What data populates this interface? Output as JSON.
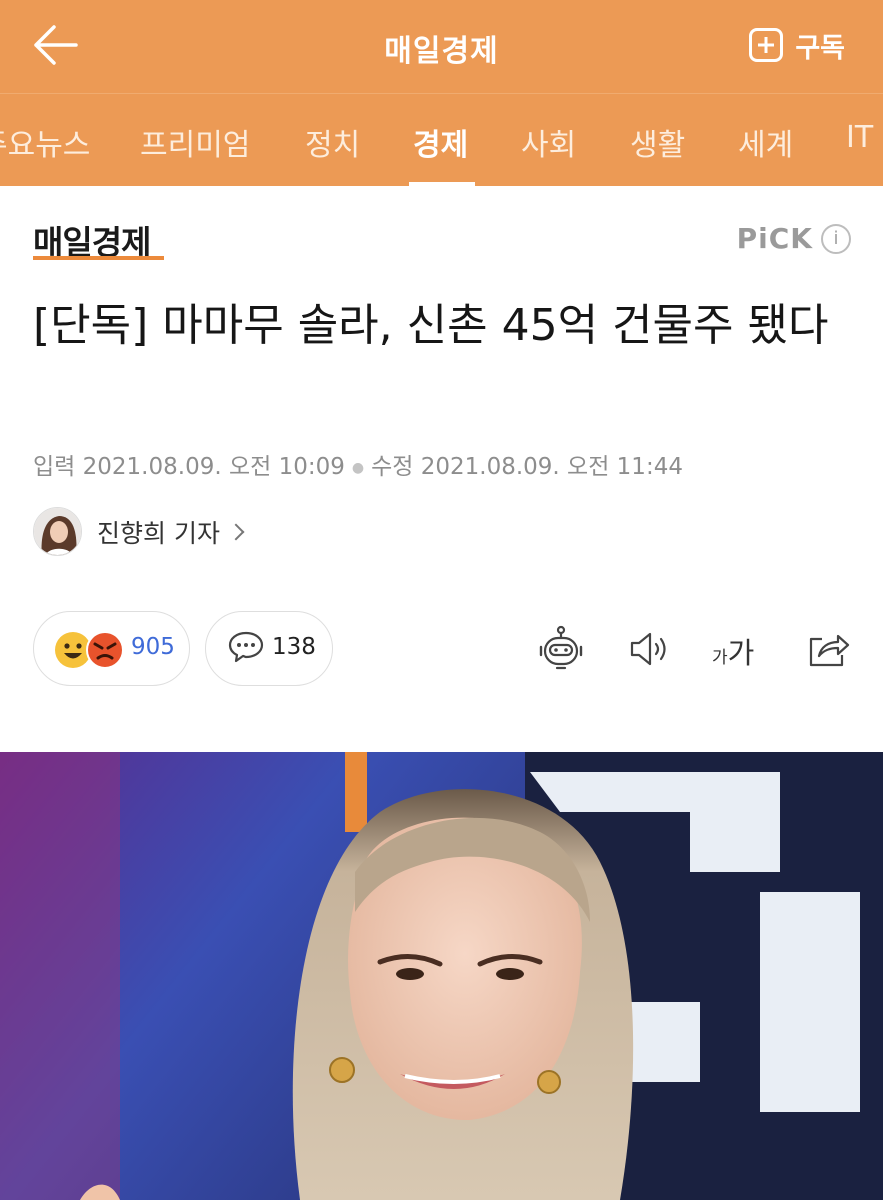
{
  "header": {
    "title": "매일경제",
    "subscribe_label": "구독"
  },
  "tabs": [
    {
      "label": "주요뉴스"
    },
    {
      "label": "프리미엄"
    },
    {
      "label": "정치"
    },
    {
      "label": "경제",
      "active": true
    },
    {
      "label": "사회"
    },
    {
      "label": "생활"
    },
    {
      "label": "세계"
    },
    {
      "label": "IT"
    }
  ],
  "article": {
    "press_logo": "매일경제",
    "pick_label": "PiCK",
    "pick_info": "i",
    "headline": "[단독] 마마무 솔라, 신촌 45억 건물주 됐다",
    "input_label": "입력",
    "input_time": "2021.08.09. 오전 10:09",
    "edit_label": "수정",
    "edit_time": "2021.08.09. 오전 11:44",
    "author": "진향희 기자"
  },
  "actions": {
    "reaction_count": "905",
    "comment_count": "138",
    "font_small": "가",
    "font_big": "가"
  },
  "colors": {
    "brand_orange": "#ec9a55",
    "logo_underline": "#ec8a3b",
    "reaction_count": "#3f6bd8"
  },
  "icons": [
    "back-arrow-icon",
    "plus-icon",
    "info-icon",
    "chevron-right-icon",
    "smile-emoji-icon",
    "angry-emoji-icon",
    "comment-icon",
    "robot-icon",
    "speaker-icon",
    "font-size-icon",
    "share-icon"
  ]
}
